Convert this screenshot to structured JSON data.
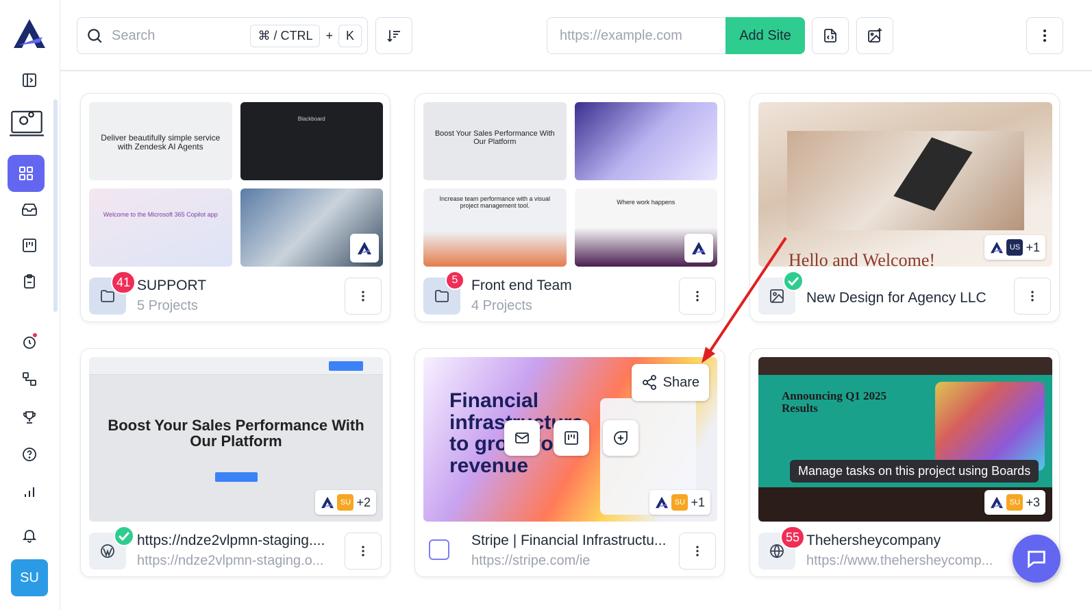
{
  "search": {
    "placeholder": "Search",
    "shortcut": "⌘ / CTRL",
    "plus": "+",
    "key": "K"
  },
  "url_input": {
    "placeholder": "https://example.com"
  },
  "add_site_label": "Add Site",
  "user_initials": "SU",
  "cards": [
    {
      "title": "SUPPORT",
      "subtitle": "5 Projects",
      "badge": "41",
      "thumbs": [
        "Deliver beautifully simple service with Zendesk AI Agents",
        "Blackboard",
        "Welcome to the Microsoft 365 Copilot app",
        ""
      ]
    },
    {
      "title": "Front end Team",
      "subtitle": "4 Projects",
      "badge": "5",
      "thumbs": [
        "Boost Your Sales Performance With Our Platform",
        "",
        "Increase team performance with a visual project management tool.",
        "Where work happens"
      ]
    },
    {
      "title": "New Design for Agency LLC",
      "thumb_text": "Hello and Welcome!",
      "avatars_extra": "+1",
      "avatar_initials": "US"
    },
    {
      "title": "https://ndze2vlpmn-staging....",
      "subtitle": "https://ndze2vlpmn-staging.o...",
      "thumb_text": "Boost Your Sales Performance With Our Platform",
      "avatars_extra": "+2",
      "avatar_initials": "SU"
    },
    {
      "title": "Stripe | Financial Infrastructu...",
      "subtitle": "https://stripe.com/ie",
      "thumb_text": "Financial infrastructure to grow your revenue",
      "share_label": "Share",
      "avatars_extra": "+1",
      "avatar_initials": "SU"
    },
    {
      "title": "Thehersheycompany",
      "subtitle": "https://www.thehersheycomp...",
      "badge": "55",
      "thumb_text": "Announcing Q1 2025 Results",
      "tooltip": "Manage tasks on this project using Boards",
      "avatars_extra": "+3",
      "avatar_initials": "SU"
    }
  ],
  "colors": {
    "accent": "#6366f1",
    "green": "#2ecc8f",
    "badge": "#ef2d56",
    "avatar": "#2b9be6"
  }
}
